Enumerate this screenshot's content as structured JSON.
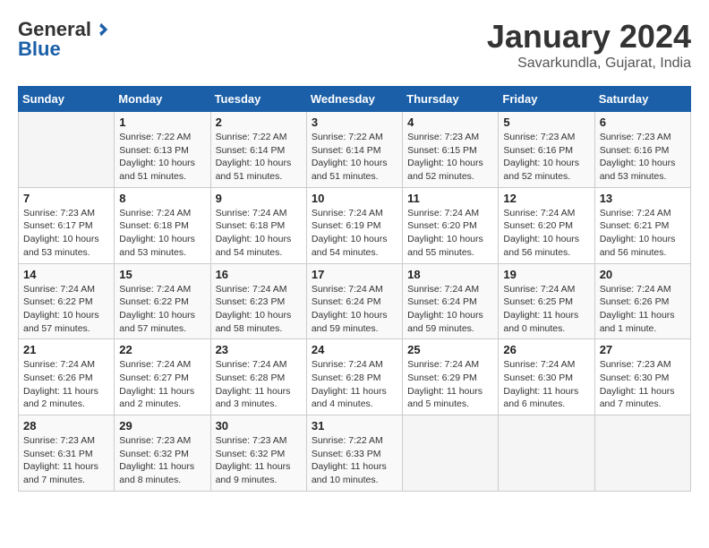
{
  "logo": {
    "general": "General",
    "blue": "Blue"
  },
  "header": {
    "month": "January 2024",
    "location": "Savarkundla, Gujarat, India"
  },
  "weekdays": [
    "Sunday",
    "Monday",
    "Tuesday",
    "Wednesday",
    "Thursday",
    "Friday",
    "Saturday"
  ],
  "weeks": [
    [
      {
        "day": null,
        "sunrise": null,
        "sunset": null,
        "daylight": null
      },
      {
        "day": "1",
        "sunrise": "Sunrise: 7:22 AM",
        "sunset": "Sunset: 6:13 PM",
        "daylight": "Daylight: 10 hours and 51 minutes."
      },
      {
        "day": "2",
        "sunrise": "Sunrise: 7:22 AM",
        "sunset": "Sunset: 6:14 PM",
        "daylight": "Daylight: 10 hours and 51 minutes."
      },
      {
        "day": "3",
        "sunrise": "Sunrise: 7:22 AM",
        "sunset": "Sunset: 6:14 PM",
        "daylight": "Daylight: 10 hours and 51 minutes."
      },
      {
        "day": "4",
        "sunrise": "Sunrise: 7:23 AM",
        "sunset": "Sunset: 6:15 PM",
        "daylight": "Daylight: 10 hours and 52 minutes."
      },
      {
        "day": "5",
        "sunrise": "Sunrise: 7:23 AM",
        "sunset": "Sunset: 6:16 PM",
        "daylight": "Daylight: 10 hours and 52 minutes."
      },
      {
        "day": "6",
        "sunrise": "Sunrise: 7:23 AM",
        "sunset": "Sunset: 6:16 PM",
        "daylight": "Daylight: 10 hours and 53 minutes."
      }
    ],
    [
      {
        "day": "7",
        "sunrise": "Sunrise: 7:23 AM",
        "sunset": "Sunset: 6:17 PM",
        "daylight": "Daylight: 10 hours and 53 minutes."
      },
      {
        "day": "8",
        "sunrise": "Sunrise: 7:24 AM",
        "sunset": "Sunset: 6:18 PM",
        "daylight": "Daylight: 10 hours and 53 minutes."
      },
      {
        "day": "9",
        "sunrise": "Sunrise: 7:24 AM",
        "sunset": "Sunset: 6:18 PM",
        "daylight": "Daylight: 10 hours and 54 minutes."
      },
      {
        "day": "10",
        "sunrise": "Sunrise: 7:24 AM",
        "sunset": "Sunset: 6:19 PM",
        "daylight": "Daylight: 10 hours and 54 minutes."
      },
      {
        "day": "11",
        "sunrise": "Sunrise: 7:24 AM",
        "sunset": "Sunset: 6:20 PM",
        "daylight": "Daylight: 10 hours and 55 minutes."
      },
      {
        "day": "12",
        "sunrise": "Sunrise: 7:24 AM",
        "sunset": "Sunset: 6:20 PM",
        "daylight": "Daylight: 10 hours and 56 minutes."
      },
      {
        "day": "13",
        "sunrise": "Sunrise: 7:24 AM",
        "sunset": "Sunset: 6:21 PM",
        "daylight": "Daylight: 10 hours and 56 minutes."
      }
    ],
    [
      {
        "day": "14",
        "sunrise": "Sunrise: 7:24 AM",
        "sunset": "Sunset: 6:22 PM",
        "daylight": "Daylight: 10 hours and 57 minutes."
      },
      {
        "day": "15",
        "sunrise": "Sunrise: 7:24 AM",
        "sunset": "Sunset: 6:22 PM",
        "daylight": "Daylight: 10 hours and 57 minutes."
      },
      {
        "day": "16",
        "sunrise": "Sunrise: 7:24 AM",
        "sunset": "Sunset: 6:23 PM",
        "daylight": "Daylight: 10 hours and 58 minutes."
      },
      {
        "day": "17",
        "sunrise": "Sunrise: 7:24 AM",
        "sunset": "Sunset: 6:24 PM",
        "daylight": "Daylight: 10 hours and 59 minutes."
      },
      {
        "day": "18",
        "sunrise": "Sunrise: 7:24 AM",
        "sunset": "Sunset: 6:24 PM",
        "daylight": "Daylight: 10 hours and 59 minutes."
      },
      {
        "day": "19",
        "sunrise": "Sunrise: 7:24 AM",
        "sunset": "Sunset: 6:25 PM",
        "daylight": "Daylight: 11 hours and 0 minutes."
      },
      {
        "day": "20",
        "sunrise": "Sunrise: 7:24 AM",
        "sunset": "Sunset: 6:26 PM",
        "daylight": "Daylight: 11 hours and 1 minute."
      }
    ],
    [
      {
        "day": "21",
        "sunrise": "Sunrise: 7:24 AM",
        "sunset": "Sunset: 6:26 PM",
        "daylight": "Daylight: 11 hours and 2 minutes."
      },
      {
        "day": "22",
        "sunrise": "Sunrise: 7:24 AM",
        "sunset": "Sunset: 6:27 PM",
        "daylight": "Daylight: 11 hours and 2 minutes."
      },
      {
        "day": "23",
        "sunrise": "Sunrise: 7:24 AM",
        "sunset": "Sunset: 6:28 PM",
        "daylight": "Daylight: 11 hours and 3 minutes."
      },
      {
        "day": "24",
        "sunrise": "Sunrise: 7:24 AM",
        "sunset": "Sunset: 6:28 PM",
        "daylight": "Daylight: 11 hours and 4 minutes."
      },
      {
        "day": "25",
        "sunrise": "Sunrise: 7:24 AM",
        "sunset": "Sunset: 6:29 PM",
        "daylight": "Daylight: 11 hours and 5 minutes."
      },
      {
        "day": "26",
        "sunrise": "Sunrise: 7:24 AM",
        "sunset": "Sunset: 6:30 PM",
        "daylight": "Daylight: 11 hours and 6 minutes."
      },
      {
        "day": "27",
        "sunrise": "Sunrise: 7:23 AM",
        "sunset": "Sunset: 6:30 PM",
        "daylight": "Daylight: 11 hours and 7 minutes."
      }
    ],
    [
      {
        "day": "28",
        "sunrise": "Sunrise: 7:23 AM",
        "sunset": "Sunset: 6:31 PM",
        "daylight": "Daylight: 11 hours and 7 minutes."
      },
      {
        "day": "29",
        "sunrise": "Sunrise: 7:23 AM",
        "sunset": "Sunset: 6:32 PM",
        "daylight": "Daylight: 11 hours and 8 minutes."
      },
      {
        "day": "30",
        "sunrise": "Sunrise: 7:23 AM",
        "sunset": "Sunset: 6:32 PM",
        "daylight": "Daylight: 11 hours and 9 minutes."
      },
      {
        "day": "31",
        "sunrise": "Sunrise: 7:22 AM",
        "sunset": "Sunset: 6:33 PM",
        "daylight": "Daylight: 11 hours and 10 minutes."
      },
      {
        "day": null,
        "sunrise": null,
        "sunset": null,
        "daylight": null
      },
      {
        "day": null,
        "sunrise": null,
        "sunset": null,
        "daylight": null
      },
      {
        "day": null,
        "sunrise": null,
        "sunset": null,
        "daylight": null
      }
    ]
  ]
}
